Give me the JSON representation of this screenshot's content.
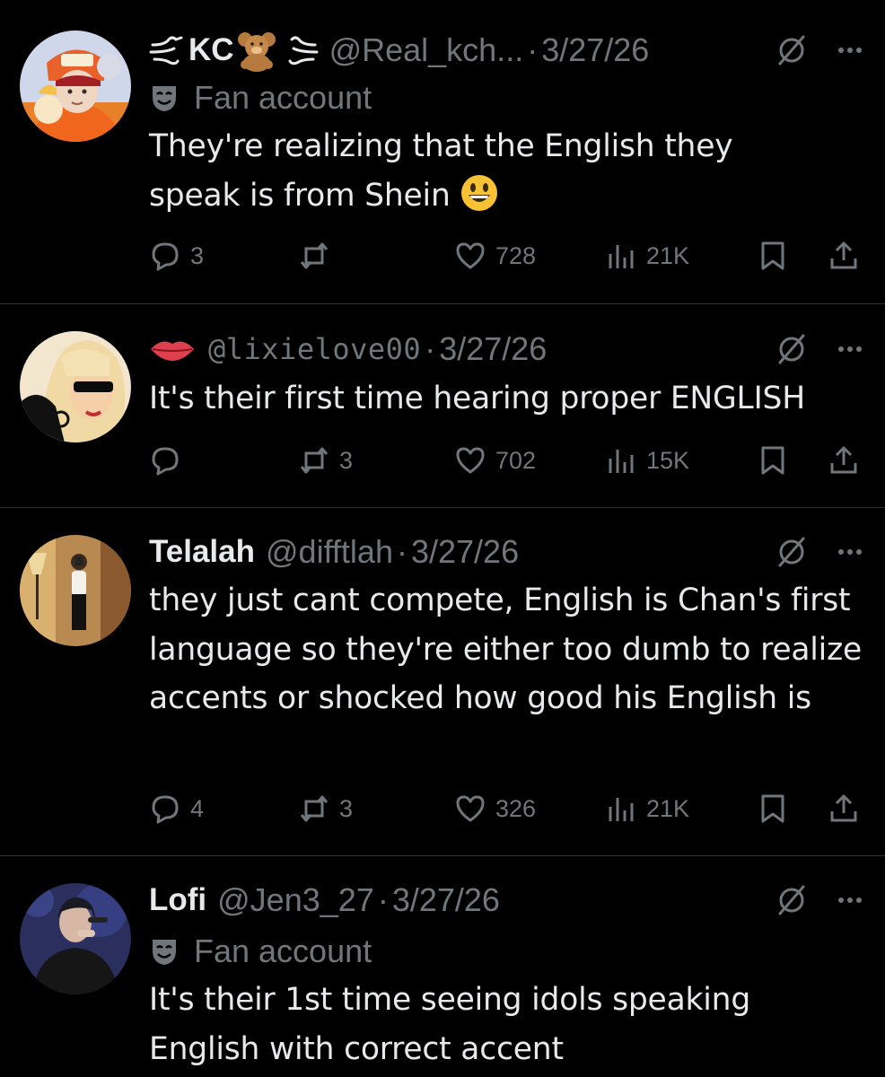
{
  "tweets": [
    {
      "display_name": "KC",
      "handle": "@Real_kch...",
      "date": "3/27/26",
      "badge": "Fan account",
      "text": "They're realizing that the English they speak is from Shein",
      "replies": "3",
      "reposts": "",
      "likes": "728",
      "views": "21K"
    },
    {
      "display_name": "",
      "handle": "@lixielove00",
      "date": "3/27/26",
      "badge": "",
      "text": "It's their first time hearing proper ENGLISH",
      "replies": "",
      "reposts": "3",
      "likes": "702",
      "views": "15K"
    },
    {
      "display_name": "Telalah",
      "handle": "@difftlah",
      "date": "3/27/26",
      "badge": "",
      "text": "they just cant compete, English is Chan's first language so they're either too dumb to realize accents or shocked how good his English is",
      "replies": "4",
      "reposts": "3",
      "likes": "326",
      "views": "21K"
    },
    {
      "display_name": "Lofi",
      "handle": "@Jen3_27",
      "date": "3/27/26",
      "badge": "Fan account",
      "text": "It's their 1st time seeing idols speaking English with correct accent"
    }
  ],
  "separator": "·",
  "colors": {
    "background": "#000000",
    "text": "#e7e9ea",
    "secondary": "#71767b",
    "divider": "#2f3336"
  },
  "icons": [
    "reply-icon",
    "repost-icon",
    "like-icon",
    "views-icon",
    "bookmark-icon",
    "share-icon",
    "grok-icon",
    "more-icon",
    "fan-mask-icon"
  ]
}
